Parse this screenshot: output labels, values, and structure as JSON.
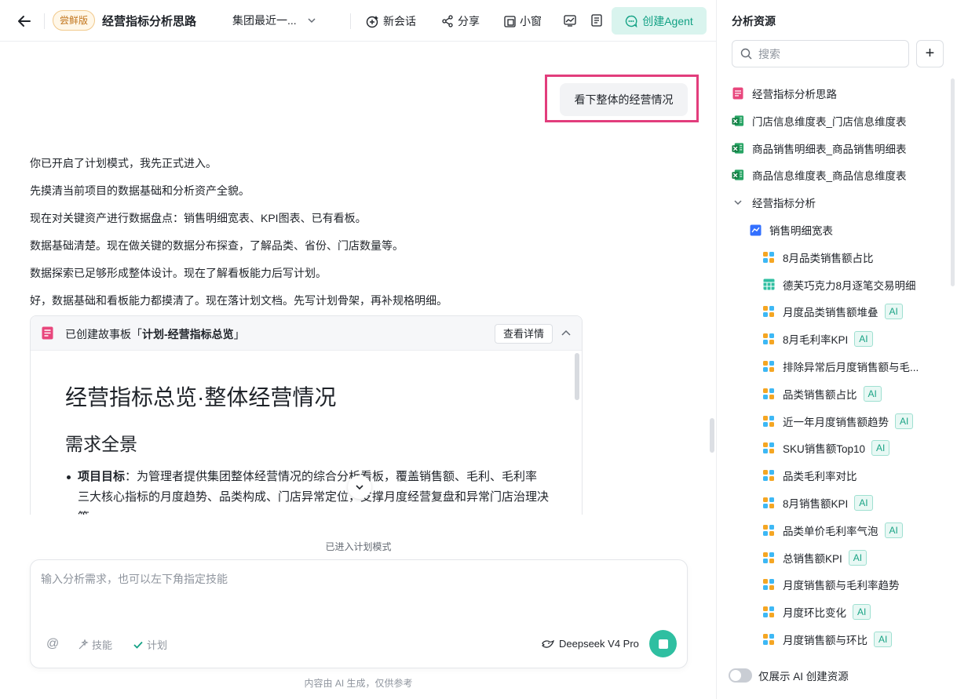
{
  "header": {
    "badge": "尝鲜版",
    "title": "经营指标分析思路",
    "scope": "集团最近一...",
    "new_chat": "新会话",
    "share": "分享",
    "mini_window": "小窗",
    "create_agent": "创建Agent"
  },
  "chat": {
    "user_message": "看下整体的经营情况",
    "ai_lines": [
      "你已开启了计划模式，我先正式进入。",
      "先摸清当前项目的数据基础和分析资产全貌。",
      "现在对关键资产进行数据盘点：销售明细宽表、KPI图表、已有看板。",
      "数据基础清楚。现在做关键的数据分布探查，了解品类、省份、门店数量等。",
      "数据探索已足够形成整体设计。现在了解看板能力后写计划。",
      "好，数据基础和看板能力都摸清了。现在落计划文档。先写计划骨架，再补规格明细。"
    ],
    "story": {
      "prefix": "已创建故事板「",
      "name": "计划-经营指标总览",
      "suffix": "」",
      "detail_button": "查看详情",
      "h1": "经营指标总览·整体经营情况",
      "h2": "需求全景",
      "li_label": "项目目标",
      "li_text": "：为管理者提供集团整体经营情况的综合分析看板，覆盖销售额、毛利、毛利率三大核心指标的月度趋势、品类构成、门店异常定位，支撑月度经营复盘和异常门店治理决策。"
    }
  },
  "composer": {
    "mode_label": "已进入计划模式",
    "placeholder": "输入分析需求，也可以左下角指定技能",
    "mention": "@",
    "skill": "技能",
    "plan": "计划",
    "model": "Deepseek V4 Pro",
    "footer_note": "内容由 AI 生成，仅供参考"
  },
  "sidebar": {
    "title": "分析资源",
    "search_placeholder": "搜索",
    "add": "+",
    "items": [
      {
        "label": "经营指标分析思路",
        "icon": "doc-icon",
        "ai": false
      },
      {
        "label": "门店信息维度表_门店信息维度表",
        "icon": "excel-icon",
        "ai": false
      },
      {
        "label": "商品销售明细表_商品销售明细表",
        "icon": "excel-icon",
        "ai": false
      },
      {
        "label": "商品信息维度表_商品信息维度表",
        "icon": "excel-icon",
        "ai": false
      },
      {
        "label": "经营指标分析",
        "icon": "chevron-down-icon",
        "ai": false
      },
      {
        "label": "销售明细宽表",
        "icon": "dataset-icon",
        "ai": false
      },
      {
        "label": "8月品类销售额占比",
        "icon": "chart-icon",
        "ai": false
      },
      {
        "label": "德芙巧克力8月逐笔交易明细",
        "icon": "table-icon",
        "ai": false
      },
      {
        "label": "月度品类销售额堆叠",
        "icon": "chart-icon",
        "ai": true
      },
      {
        "label": "8月毛利率KPI",
        "icon": "chart-icon",
        "ai": true
      },
      {
        "label": "排除异常后月度销售额与毛...",
        "icon": "chart-icon",
        "ai": false
      },
      {
        "label": "品类销售额占比",
        "icon": "chart-icon",
        "ai": true
      },
      {
        "label": "近一年月度销售额趋势",
        "icon": "chart-icon",
        "ai": true
      },
      {
        "label": "SKU销售额Top10",
        "icon": "chart-icon",
        "ai": true
      },
      {
        "label": "品类毛利率对比",
        "icon": "chart-icon",
        "ai": false
      },
      {
        "label": "8月销售额KPI",
        "icon": "chart-icon",
        "ai": true
      },
      {
        "label": "品类单价毛利率气泡",
        "icon": "chart-icon",
        "ai": true
      },
      {
        "label": "总销售额KPI",
        "icon": "chart-icon",
        "ai": true
      },
      {
        "label": "月度销售额与毛利率趋势",
        "icon": "chart-icon",
        "ai": false
      },
      {
        "label": "月度环比变化",
        "icon": "chart-icon",
        "ai": true
      },
      {
        "label": "月度销售额与环比",
        "icon": "chart-icon",
        "ai": true
      }
    ],
    "ai_badge": "AI",
    "toggle_label": "仅展示 AI 创建资源"
  },
  "colors": {
    "accent": "#12a184",
    "highlight": "#e23d7c",
    "trial_badge": "#c1741b"
  }
}
